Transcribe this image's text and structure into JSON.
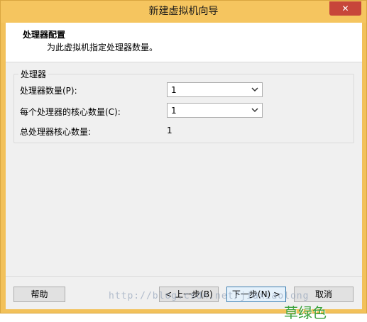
{
  "window": {
    "title": "新建虚拟机向导",
    "close_glyph": "✕"
  },
  "header": {
    "title": "处理器配置",
    "subtitle": "为此虚拟机指定处理器数量。"
  },
  "processors": {
    "group_label": "处理器",
    "count_label": "处理器数量(P):",
    "count_value": "1",
    "cores_label": "每个处理器的核心数量(C):",
    "cores_value": "1",
    "total_label": "总处理器核心数量:",
    "total_value": "1"
  },
  "footer": {
    "help_label": "帮助",
    "back_label": "< 上一步(B)",
    "next_label": "下一步(N) >",
    "cancel_label": "取消"
  },
  "watermark": {
    "url": "http://blog.csdn.net/jiaxiaolong",
    "logo": "草绿色"
  },
  "colors": {
    "titlebar": "#f5c55f",
    "close": "#c7463a",
    "client": "#f0f0f0"
  }
}
